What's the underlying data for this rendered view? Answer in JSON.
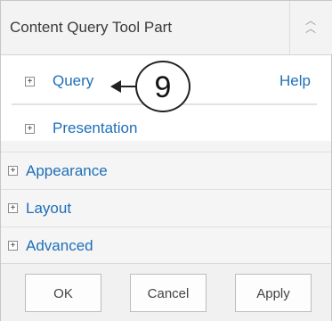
{
  "panel": {
    "title": "Content Query Tool Part",
    "collapse_icon": "double-chevron-up-icon"
  },
  "content": {
    "query_label": "Query",
    "help_label": "Help",
    "presentation_label": "Presentation"
  },
  "sections": [
    {
      "label": "Appearance"
    },
    {
      "label": "Layout"
    },
    {
      "label": "Advanced"
    }
  ],
  "buttons": {
    "ok": "OK",
    "cancel": "Cancel",
    "apply": "Apply"
  },
  "callout": {
    "number": "9"
  },
  "colors": {
    "link": "#1e6fb8",
    "panel_bg": "#f4f4f4",
    "border": "#c6c6c6"
  }
}
